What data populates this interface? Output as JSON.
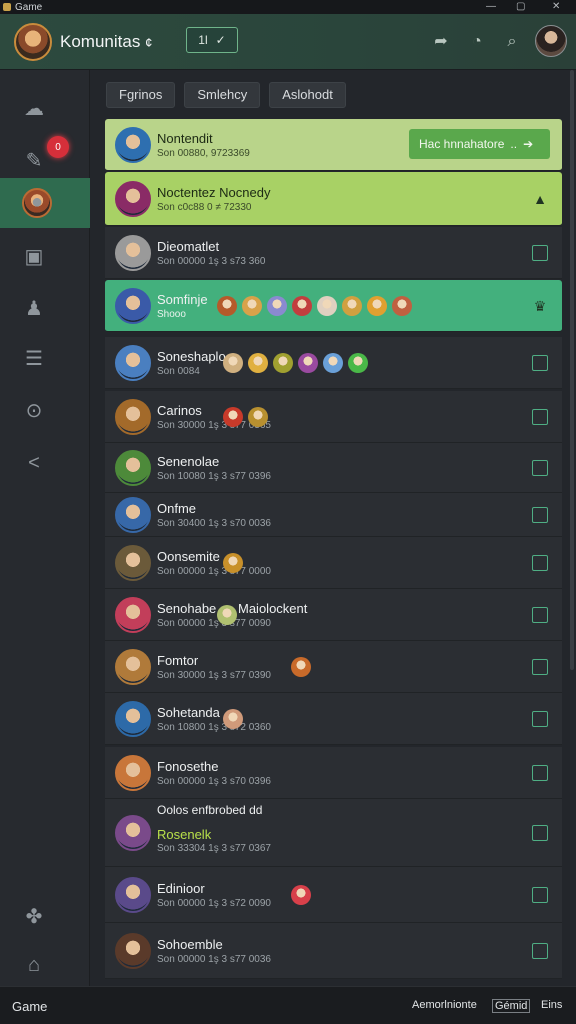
{
  "window": {
    "title": "Game",
    "controls": [
      "—",
      "▢",
      "✕"
    ]
  },
  "header": {
    "title": "Komunitas",
    "title_suffix": "¢",
    "chip_text": "1l",
    "chip_check": "✓",
    "icons": [
      "share-icon",
      "clock-icon",
      "search-icon"
    ]
  },
  "sidebar": {
    "items": [
      {
        "icon": "cloud-icon",
        "glyph": "☁"
      },
      {
        "icon": "edit-icon",
        "glyph": "✎",
        "badge": "0"
      },
      {
        "icon": "profile-icon",
        "glyph": "●",
        "active": true
      },
      {
        "icon": "trash-icon",
        "glyph": "▣"
      },
      {
        "icon": "people-icon",
        "glyph": "♟"
      },
      {
        "icon": "list-icon",
        "glyph": "☰"
      },
      {
        "icon": "help-icon",
        "glyph": "⊙"
      },
      {
        "icon": "share-icon",
        "glyph": "<"
      },
      {
        "icon": "puzzle-icon",
        "glyph": "✤"
      },
      {
        "icon": "home-icon",
        "glyph": "⌂"
      }
    ]
  },
  "tabs": [
    "Fgrinos",
    "Smlehcy",
    "Aslohodt"
  ],
  "rows": [
    {
      "name": "Nontendit",
      "sub": "Son 00880, 9723369",
      "style": "hl1",
      "accept_label": "Hac hnnahatore",
      "accept_suffix": "..",
      "color": "#2e6fb0"
    },
    {
      "name": "Noctentez Nocnedy",
      "sub": "Son c0c88 0 ≠ 72330",
      "style": "hl2",
      "action": "▲",
      "color": "#8a2b66"
    },
    {
      "name": "Dieomatlet",
      "sub": "Son 00000 1ş 3 s73 360",
      "style": "",
      "color": "#9a9a9a"
    },
    {
      "name": "Somfinje",
      "sub": "Shooo",
      "style": "hl3",
      "action": "♛",
      "color": "#3a5aa8"
    },
    {
      "name": "Soneshaplo",
      "sub": "Son 0084",
      "style": "",
      "color": "#4a7fc0"
    },
    {
      "name": "Carinos",
      "sub": "Son 30000 1ş 3 s77 0365",
      "style": "",
      "color": "#a36a2a"
    },
    {
      "name": "Senenolae",
      "sub": "Son 10080 1ş 3 s77 0396",
      "style": "",
      "color": "#4d8a3a"
    },
    {
      "name": "Onfme",
      "sub": "Son 30400 1ş 3 s70 0036",
      "style": "",
      "color": "#3768a8"
    },
    {
      "name": "Oonsemite",
      "sub": "Son 00000 1ş 3 s77 0000",
      "style": "",
      "color": "#6b5a3a"
    },
    {
      "name": "Senohabe",
      "name_extra": "Maiolockent",
      "sub": "Son 00000 1ş 3 s77 0090",
      "style": "",
      "color": "#c23e5a"
    },
    {
      "name": "Fomtor",
      "sub": "Son 30000 1ş 3 s77 0390",
      "style": "",
      "color": "#b07a3a"
    },
    {
      "name": "Sohetanda",
      "sub": "Son 10800 1ş 3 s72 0360",
      "style": "",
      "color": "#2d6aa8"
    },
    {
      "name": "Fonosethe",
      "sub": "Son 00000 1ş 3 s70 0396",
      "style": "",
      "color": "#c8763a"
    },
    {
      "name": "Rosenelk",
      "name_top": "Oolos enfbrobed dd",
      "sub": "Son 33304 1ş 3 s77 0367",
      "style": "",
      "color": "#7a4a8a"
    },
    {
      "name": "Edinioor",
      "sub": "Son 00000 1ş 3 s72 0090",
      "style": "",
      "color": "#5a4a8a"
    },
    {
      "name": "Sohoemble",
      "sub": "Son 00000 1ş 3 s77 0036",
      "style": "",
      "color": "#5a3a2a"
    }
  ],
  "footer": {
    "left": "Game",
    "center": "Aemorlnionte",
    "link": "Gémid",
    "right": "Eins"
  }
}
